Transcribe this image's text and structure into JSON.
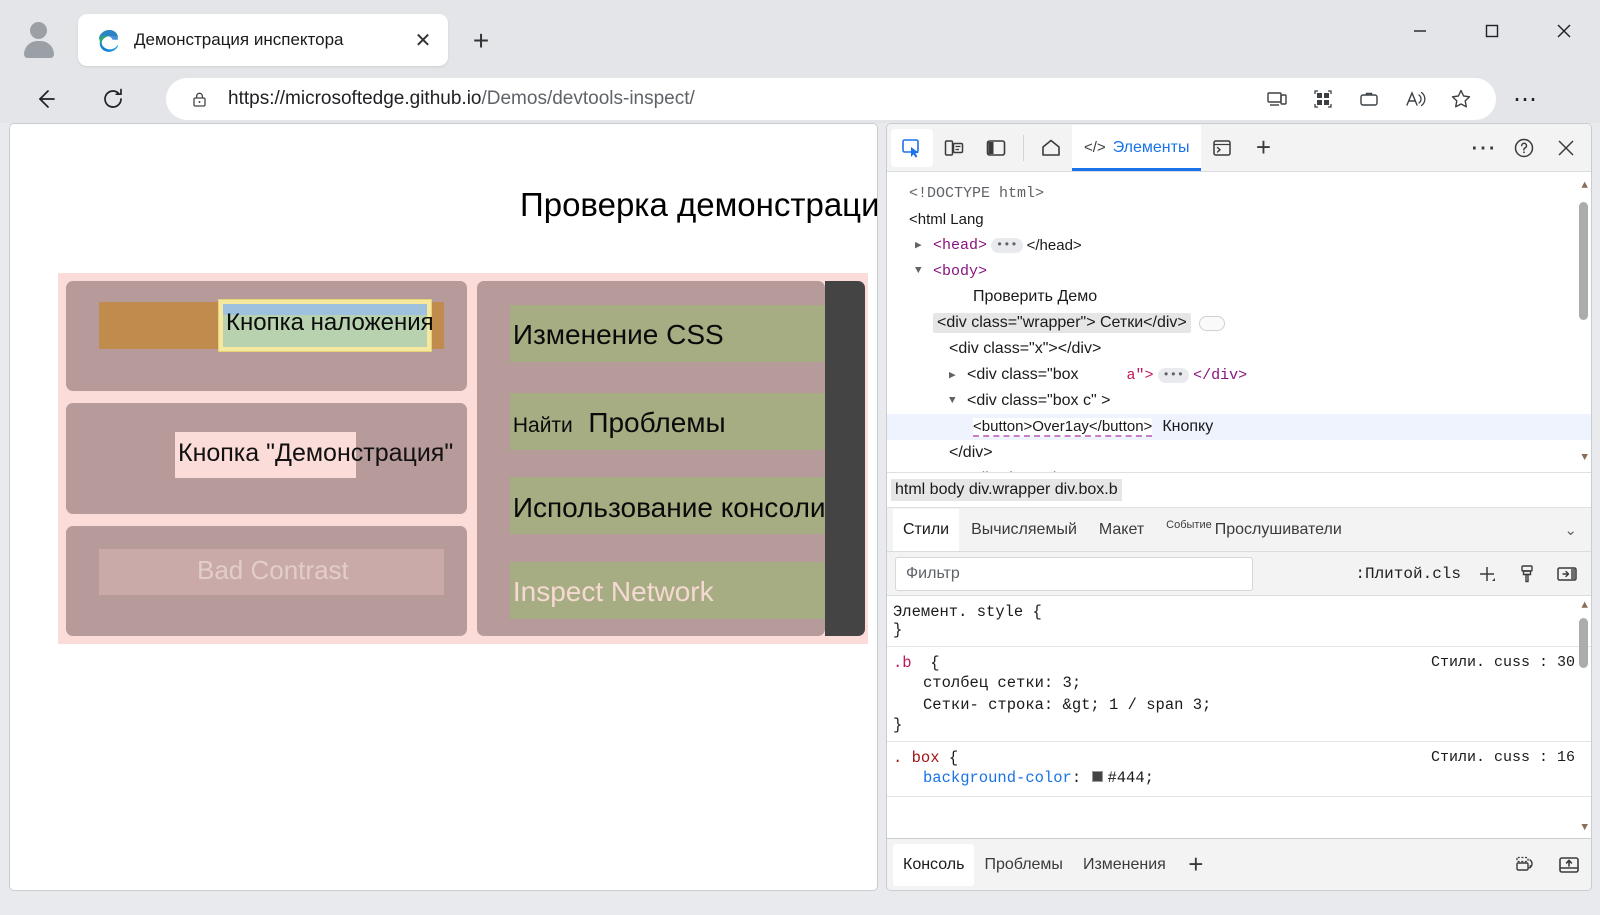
{
  "browser": {
    "tab": {
      "title": "Демонстрация инспектора",
      "close_label": "✕"
    },
    "new_tab_label": "+",
    "window_controls": {
      "minimize": "minimize-icon",
      "maximize": "maximize-icon",
      "close": "close-icon"
    },
    "address": {
      "protocol_host": "https://microsoftedge.github.io",
      "path": "/Demos/devtools-inspect/",
      "full_url": "https://microsoftedge.github.io/Demos/devtools-inspect/"
    },
    "toolbar_icons": [
      "cast-icon",
      "collections-grid-icon",
      "browser-essentials-icon",
      "read-aloud-icon",
      "favorite-star-icon"
    ],
    "settings_label": "⋯"
  },
  "page": {
    "title": "Проверка демонстрации",
    "left_column": {
      "overlay_button": "Кнопка наложения",
      "demo_button": "Кнопка \"Демонстрация\"",
      "bad_contrast_button": "Bad Contrast"
    },
    "right_column": {
      "buttons": [
        {
          "label": "Изменение CSS",
          "muted": false,
          "prefix": ""
        },
        {
          "label": "Проблемы",
          "muted": false,
          "prefix": "Найти"
        },
        {
          "label": "Использование консоли",
          "muted": false,
          "prefix": ""
        },
        {
          "label": "Inspect Network",
          "muted": true,
          "prefix": ""
        }
      ]
    },
    "colors": {
      "wrapper_bg": "#fbdcd8",
      "box_bg": "#b79a9a",
      "green_btn": "#a7ad82",
      "dark_box": "#444444",
      "overlay_margin": "#f7e8a0",
      "overlay_padding": "#b8d2b0",
      "overlay_content": "#9ec1e0"
    }
  },
  "devtools": {
    "toolbar": {
      "inspect_icon": "inspect-element-icon",
      "device_icon": "device-emulation-icon",
      "dock_icon": "dock-side-icon",
      "home_icon": "home-icon",
      "tabs": [
        {
          "label": "Элементы",
          "icon": "code-brackets-icon",
          "selected": true
        }
      ],
      "console_icon": "console-terminal-icon",
      "add_tab_label": "+",
      "more_label": "⋯",
      "help_icon": "help-question-icon",
      "close_icon": "close-icon"
    },
    "dom_tree": [
      {
        "indent": 0,
        "triangle": "",
        "text": "<!DOCTYPE html>",
        "kind": "doctype"
      },
      {
        "indent": 0,
        "triangle": "",
        "text": "<html Lang",
        "kind": "plain"
      },
      {
        "indent": 1,
        "triangle": "▶",
        "text": "<head> … </head>",
        "kind": "tag"
      },
      {
        "indent": 1,
        "triangle": "▼",
        "text": "<body>",
        "kind": "tag"
      },
      {
        "indent": 3,
        "triangle": "",
        "text": "Проверить        Демо",
        "kind": "text"
      },
      {
        "indent": 2,
        "triangle": "V",
        "text": "<div class=\"wrapper\"> Сетки</div>",
        "kind": "highlight"
      },
      {
        "indent": 3,
        "triangle": "",
        "text": "<div class=\"x\"></div>",
        "kind": "plain"
      },
      {
        "indent": 3,
        "triangle": "▶",
        "text": "<div class=\"box          a\"> … </div>",
        "kind": "plain"
      },
      {
        "indent": 3,
        "triangle": "▼",
        "text": "<div class=\"box c\" >",
        "kind": "plain"
      },
      {
        "indent": 4,
        "triangle": "",
        "text": "<button>Over1ay</button>  Кнопку",
        "kind": "selected"
      },
      {
        "indent": 3,
        "triangle": "",
        "text": "</div>",
        "kind": "plain"
      },
      {
        "indent": 3,
        "triangle": "▶",
        "text": "<div class=\"box          d\"> … </div>",
        "kind": "plain"
      }
    ],
    "breadcrumb": "html body div.wrapper div.box.b",
    "style_tabs": [
      {
        "label": "Стили",
        "selected": true,
        "sup": ""
      },
      {
        "label": "Вычисляемый",
        "selected": false,
        "sup": ""
      },
      {
        "label": "Макет",
        "selected": false,
        "sup": ""
      },
      {
        "label": "Прослушиватели",
        "selected": false,
        "sup": "Событие"
      }
    ],
    "style_tabs_overflow": "⌄",
    "filter": {
      "placeholder": "Фильтр",
      "value": ""
    },
    "filter_actions": {
      "toggle_class": ":Плитой.cls",
      "new_rule_label": "+",
      "copy_styles_icon": "paintbrush-icon",
      "computed_sidebar_icon": "show-sidebar-icon"
    },
    "css_rules": [
      {
        "selector": "Элемент. style",
        "selector_kind": "element",
        "source": "",
        "declarations": []
      },
      {
        "selector": ".b",
        "selector_kind": "class",
        "source": "Стили. cuss : 30",
        "declarations": [
          {
            "prop": "столбец сетки",
            "value": "3;",
            "swatch": false
          },
          {
            "prop": "Сетки- строка",
            "value": "&gt; 1 / span 3;",
            "swatch": false
          }
        ]
      },
      {
        "selector": ". box",
        "selector_kind": "class",
        "source": "Стили. cuss : 16",
        "declarations": [
          {
            "prop": "background-color",
            "value": "#444;",
            "swatch": true
          }
        ]
      }
    ],
    "drawer_tabs": [
      {
        "label": "Консоль",
        "selected": true
      },
      {
        "label": "Проблемы",
        "selected": false
      },
      {
        "label": "Изменения",
        "selected": false
      }
    ],
    "drawer_add_label": "+",
    "drawer_icons": [
      "restore-drawer-icon",
      "dock-bottom-icon"
    ]
  }
}
